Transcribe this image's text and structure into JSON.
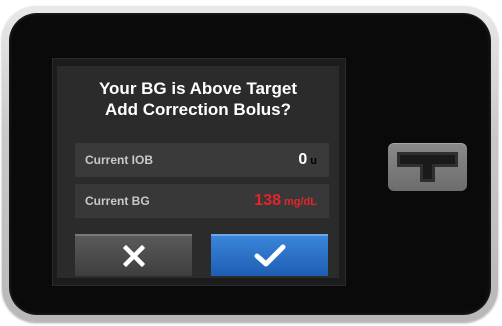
{
  "dialog": {
    "title_line1": "Your BG is Above Target",
    "title_line2": "Add Correction Bolus?",
    "rows": [
      {
        "label": "Current IOB",
        "value": "0",
        "unit": "u"
      },
      {
        "label": "Current BG",
        "value": "138",
        "unit": "mg/dL"
      }
    ],
    "cancel_icon": "close-x-icon",
    "confirm_icon": "checkmark-icon"
  },
  "device": {
    "logo_icon": "t-logo-icon"
  },
  "colors": {
    "bg_alert": "#e3242b",
    "confirm_blue": "#2a72c8",
    "dialog_bg": "#2b2b2b"
  }
}
